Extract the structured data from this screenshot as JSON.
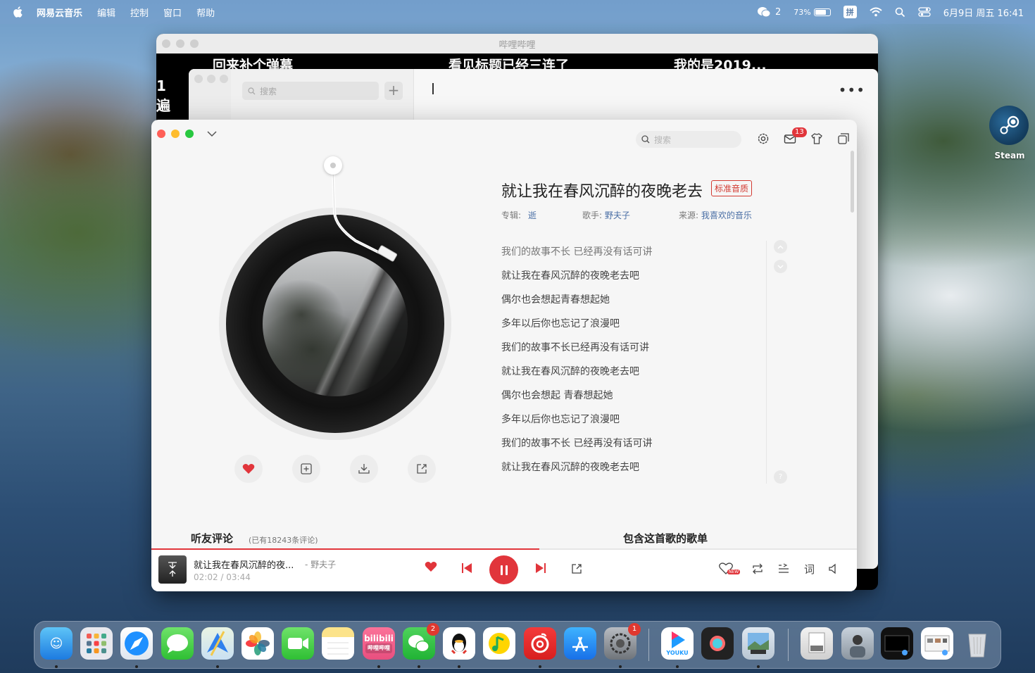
{
  "menubar": {
    "app_name": "网易云音乐",
    "items": [
      "编辑",
      "控制",
      "窗口",
      "帮助"
    ],
    "wechat_count": "2",
    "battery": "73%",
    "input_method": "拼",
    "datetime": "6月9日 周五 16:41"
  },
  "bilibili_window": {
    "title": "哔哩哔哩",
    "danmaku": [
      "回来补个弹幕",
      "看见标题已经三连了",
      "我的是2019..."
    ],
    "side_text": "1\n遍"
  },
  "mid_window": {
    "search_placeholder": "搜索"
  },
  "player": {
    "search_placeholder": "搜索",
    "mail_badge": "13",
    "song": {
      "title": "就让我在春风沉醉的夜晚老去",
      "quality": "标准音质",
      "album_label": "专辑:",
      "album": "逝",
      "artist_label": "歌手:",
      "artist": "野夫子",
      "source_label": "来源:",
      "source": "我喜欢的音乐"
    },
    "lyrics": [
      "我们的故事不长 已经再没有话可讲",
      "就让我在春风沉醉的夜晚老去吧",
      "偶尔也会想起青春想起她",
      "多年以后你也忘记了浪漫吧",
      "我们的故事不长已经再没有话可讲",
      "就让我在春风沉醉的夜晚老去吧",
      "偶尔也会想起 青春想起她",
      "多年以后你也忘记了浪漫吧",
      "我们的故事不长 已经再没有话可讲",
      "就让我在春风沉醉的夜晚老去吧"
    ],
    "comments_heading": "听友评论",
    "comments_count": "(已有18243条评论)",
    "playlist_heading": "包含这首歌的歌单",
    "bar": {
      "title": "就让我在春风沉醉的夜...",
      "artist": "- 野夫子",
      "elapsed": "02:02 /",
      "duration": "03:44",
      "progress": 0.55,
      "new_tag": "NEW",
      "lyric_btn": "词"
    }
  },
  "desktop": {
    "steam_label": "Steam"
  },
  "dock": {
    "wechat_badge": "2",
    "settings_badge": "1",
    "bilibili_label": "bilibili",
    "bilibili_sub": "哔哩哔哩",
    "youku_label": "YOUKU"
  },
  "colors": {
    "accent": "#e1353b",
    "link": "#4a6fa5"
  }
}
